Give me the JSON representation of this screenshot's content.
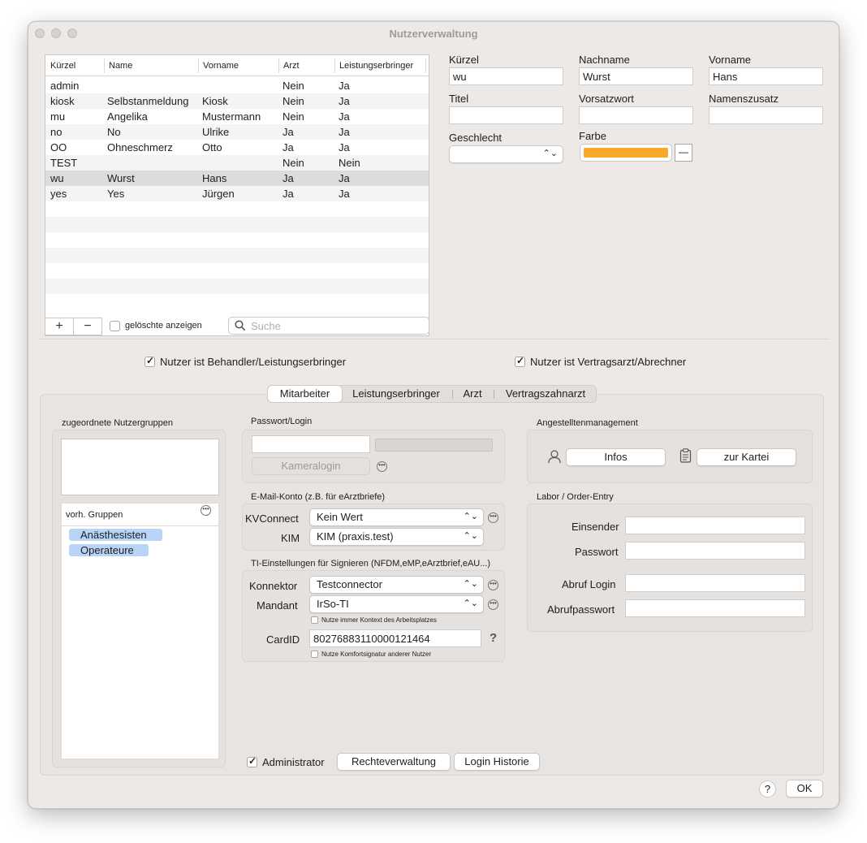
{
  "window": {
    "title": "Nutzerverwaltung"
  },
  "user_table": {
    "columns": [
      "Kürzel",
      "Name",
      "Vorname",
      "Arzt",
      "Leistungserbringer"
    ],
    "rows": [
      {
        "kuerzel": "admin",
        "name": "",
        "vorname": "",
        "arzt": "Nein",
        "leistungserbringer": "Ja"
      },
      {
        "kuerzel": "kiosk",
        "name": "Selbstanmeldung",
        "vorname": "Kiosk",
        "arzt": "Nein",
        "leistungserbringer": "Ja"
      },
      {
        "kuerzel": "mu",
        "name": "Angelika",
        "vorname": "Mustermann",
        "arzt": "Nein",
        "leistungserbringer": "Ja"
      },
      {
        "kuerzel": "no",
        "name": "No",
        "vorname": "Ulrike",
        "arzt": "Ja",
        "leistungserbringer": "Ja"
      },
      {
        "kuerzel": "OO",
        "name": "Ohneschmerz",
        "vorname": "Otto",
        "arzt": "Ja",
        "leistungserbringer": "Ja"
      },
      {
        "kuerzel": "TEST",
        "name": "",
        "vorname": "",
        "arzt": "Nein",
        "leistungserbringer": "Nein"
      },
      {
        "kuerzel": "wu",
        "name": "Wurst",
        "vorname": "Hans",
        "arzt": "Ja",
        "leistungserbringer": "Ja"
      },
      {
        "kuerzel": "yes",
        "name": "Yes",
        "vorname": "Jürgen",
        "arzt": "Ja",
        "leistungserbringer": "Ja"
      }
    ],
    "selected_kuerzel": "wu",
    "add_label": "+",
    "remove_label": "−",
    "show_deleted_label": "gelöschte anzeigen",
    "show_deleted_checked": false,
    "search_placeholder": "Suche"
  },
  "details": {
    "kuerzel_label": "Kürzel",
    "kuerzel_value": "wu",
    "nachname_label": "Nachname",
    "nachname_value": "Wurst",
    "vorname_label": "Vorname",
    "vorname_value": "Hans",
    "titel_label": "Titel",
    "titel_value": "",
    "vorsatzwort_label": "Vorsatzwort",
    "vorsatzwort_value": "",
    "namenszusatz_label": "Namenszusatz",
    "namenszusatz_value": "",
    "geschlecht_label": "Geschlecht",
    "geschlecht_value": "",
    "farbe_label": "Farbe",
    "farbe_color": "#f8a92a",
    "farbe_clear_label": "—"
  },
  "flags": {
    "behandler_label": "Nutzer ist Behandler/Leistungserbringer",
    "behandler_checked": true,
    "vertragsarzt_label": "Nutzer ist Vertragsarzt/Abrechner",
    "vertragsarzt_checked": true
  },
  "tabs": [
    {
      "label": "Mitarbeiter",
      "active": true
    },
    {
      "label": "Leistungserbringer",
      "active": false
    },
    {
      "label": "Arzt",
      "active": false
    },
    {
      "label": "Vertragszahnarzt",
      "active": false
    }
  ],
  "groups": {
    "title": "zugeordnete Nutzergruppen",
    "available_label": "vorh. Gruppen",
    "available": [
      "Anästhesisten",
      "Operateure"
    ]
  },
  "password": {
    "title": "Passwort/Login",
    "password_value": "",
    "camera_login_label": "Kameralogin"
  },
  "email": {
    "title": "E-Mail-Konto (z.B. für eArztbriefe)",
    "kvconnect_label": "KVConnect",
    "kvconnect_value": "Kein Wert",
    "kim_label": "KIM",
    "kim_value": "KIM (praxis.test)"
  },
  "ti": {
    "title": "TI-Einstellungen für Signieren (NFDM,eMP,eArztbrief,eAU...)",
    "konnektor_label": "Konnektor",
    "konnektor_value": "Testconnector",
    "mandant_label": "Mandant",
    "mandant_value": "IrSo-TI",
    "context_label": "Nutze immer Kontext des Arbeitsplatzes",
    "context_checked": false,
    "cardid_label": "CardID",
    "cardid_value": "80276883110000121464",
    "help_label": "?",
    "comfort_label": "Nutze Komfortsignatur anderer Nutzer",
    "comfort_checked": false
  },
  "employee": {
    "title": "Angestelltenmanagement",
    "infos_label": "Infos",
    "kartei_label": "zur Kartei"
  },
  "labor": {
    "title": "Labor / Order-Entry",
    "einsender_label": "Einsender",
    "einsender_value": "",
    "passwort_label": "Passwort",
    "passwort_value": "",
    "abruf_login_label": "Abruf Login",
    "abruf_login_value": "",
    "abrufpasswort_label": "Abrufpasswort",
    "abrufpasswort_value": ""
  },
  "bottom": {
    "admin_label": "Administrator",
    "admin_checked": true,
    "rights_label": "Rechteverwaltung",
    "history_label": "Login Historie",
    "help_label": "?",
    "ok_label": "OK"
  }
}
